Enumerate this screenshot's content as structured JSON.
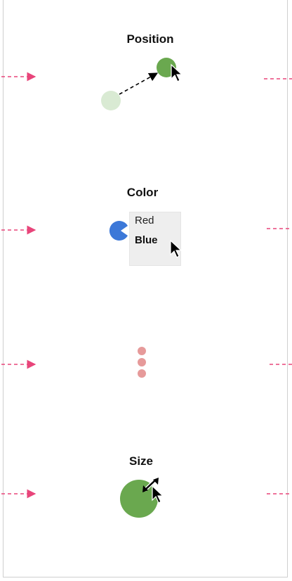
{
  "sections": {
    "position": {
      "title": "Position"
    },
    "color": {
      "title": "Color"
    },
    "size": {
      "title": "Size"
    }
  },
  "color_menu": {
    "options": [
      "Red",
      "Blue"
    ],
    "selected": "Blue"
  },
  "colors": {
    "green": "#6aa84f",
    "green_faded": "#d9ead3",
    "blue": "#3c78d8",
    "pink_dots": "#e69a9a",
    "arrow_magenta": "#e8457a"
  },
  "icons": [
    "cursor-icon",
    "resize-icon",
    "arrow-icon"
  ]
}
